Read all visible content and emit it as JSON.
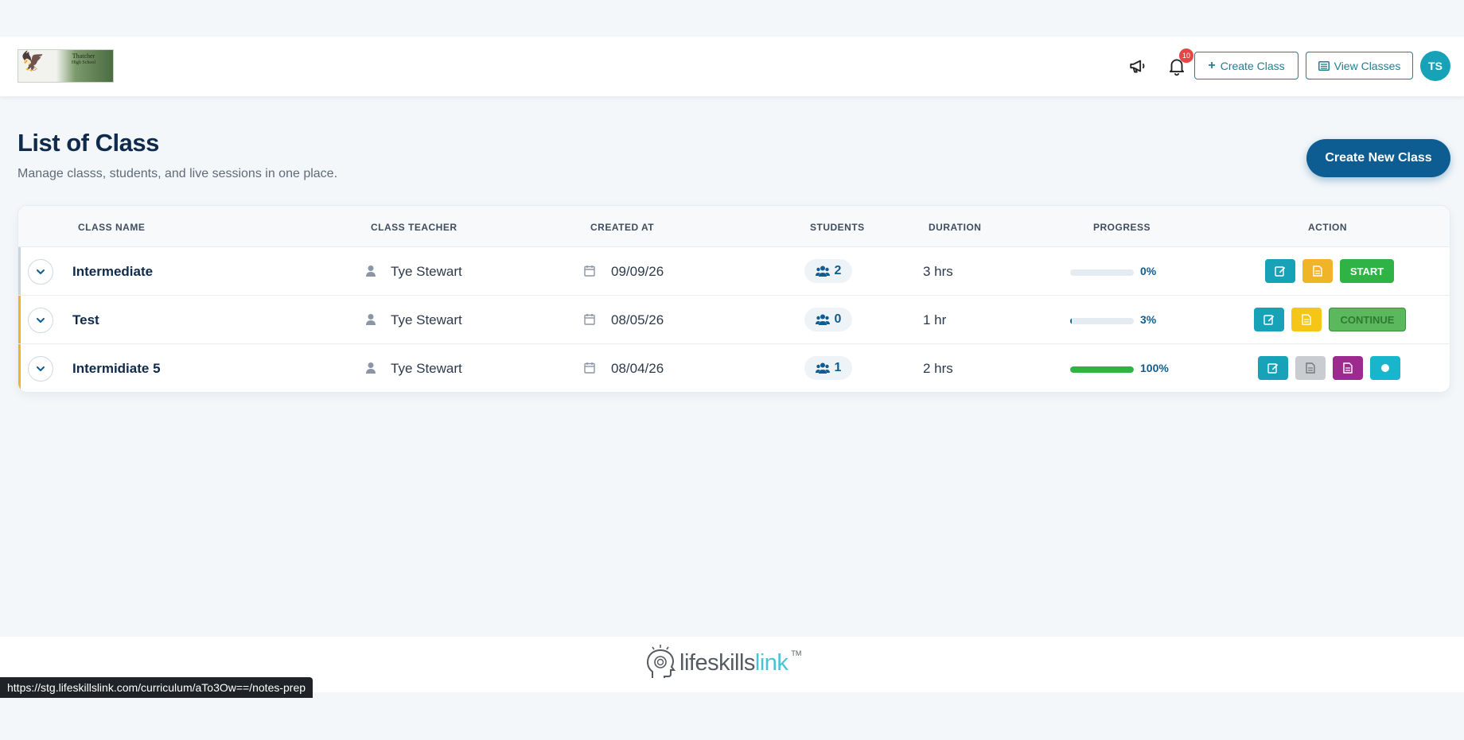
{
  "header": {
    "logo_text": "Thatcher",
    "logo_subtext": "High School",
    "notification_count": "10",
    "create_class_label": "Create Class",
    "view_classes_label": "View Classes",
    "avatar_initials": "TS"
  },
  "page": {
    "title": "List of Class",
    "subtitle": "Manage classs, students, and live sessions in one place.",
    "create_new_label": "Create New Class"
  },
  "table": {
    "columns": [
      "CLASS NAME",
      "CLASS TEACHER",
      "CREATED AT",
      "STUDENTS",
      "DURATION",
      "PROGRESS",
      "ACTION"
    ],
    "rows": [
      {
        "name": "Intermediate",
        "teacher": "Tye Stewart",
        "created": "09/09/26",
        "students": "2",
        "duration": "3 hrs",
        "progress": 0,
        "progress_label": "0%",
        "action_label": "START",
        "accent": "#c9d6e2"
      },
      {
        "name": "Test",
        "teacher": "Tye Stewart",
        "created": "08/05/26",
        "students": "0",
        "duration": "1 hr",
        "progress": 3,
        "progress_label": "3%",
        "action_label": "CONTINUE",
        "accent": "#f0b429"
      },
      {
        "name": "Intermidiate 5",
        "teacher": "Tye Stewart",
        "created": "08/04/26",
        "students": "1",
        "duration": "2 hrs",
        "progress": 100,
        "progress_label": "100%",
        "accent": "#f0b429"
      }
    ]
  },
  "colors": {
    "primary": "#0e5d92",
    "teal": "#17a2b8",
    "yellow": "#f0b429",
    "green": "#2fb344",
    "purple": "#9c2a8f",
    "gray": "#c9ccd0"
  },
  "footer": {
    "brand_part1": "lifeskills",
    "brand_part2": "link",
    "trademark": "TM"
  },
  "status_url": "https://stg.lifeskillslink.com/curriculum/aTo3Ow==/notes-prep"
}
